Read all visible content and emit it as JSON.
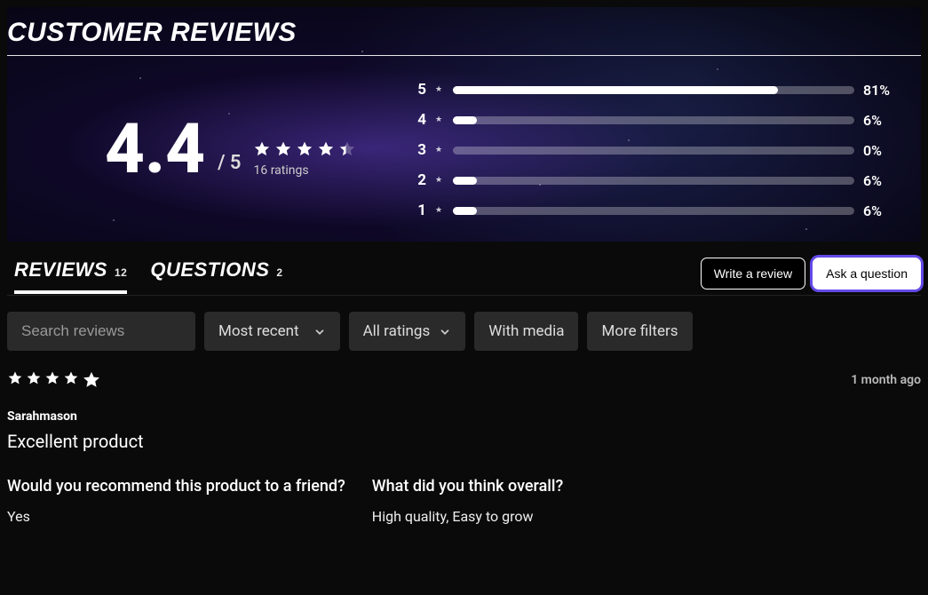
{
  "header": {
    "title": "Customer Reviews"
  },
  "summary": {
    "score": "4.4",
    "out_of": "/ 5",
    "ratings_count": "16 ratings",
    "star_fill": 4.4,
    "distribution": [
      {
        "label": "5",
        "pct": 81,
        "pct_label": "81%"
      },
      {
        "label": "4",
        "pct": 6,
        "pct_label": "6%"
      },
      {
        "label": "3",
        "pct": 0,
        "pct_label": "0%"
      },
      {
        "label": "2",
        "pct": 6,
        "pct_label": "6%"
      },
      {
        "label": "1",
        "pct": 6,
        "pct_label": "6%"
      }
    ]
  },
  "tabs": {
    "reviews_label": "Reviews",
    "reviews_count": "12",
    "questions_label": "Questions",
    "questions_count": "2"
  },
  "actions": {
    "write_review": "Write a review",
    "ask_question": "Ask a question"
  },
  "filters": {
    "search_placeholder": "Search reviews",
    "sort": "Most recent",
    "rating": "All ratings",
    "media": "With media",
    "more": "More filters"
  },
  "review": {
    "stars": 5,
    "date": "1 month ago",
    "author": "Sarahmason",
    "title": "Excellent product",
    "qa": [
      {
        "q": "Would you recommend this product to a friend?",
        "a": "Yes"
      },
      {
        "q": "What did you think overall?",
        "a": "High quality, Easy to grow"
      }
    ]
  }
}
